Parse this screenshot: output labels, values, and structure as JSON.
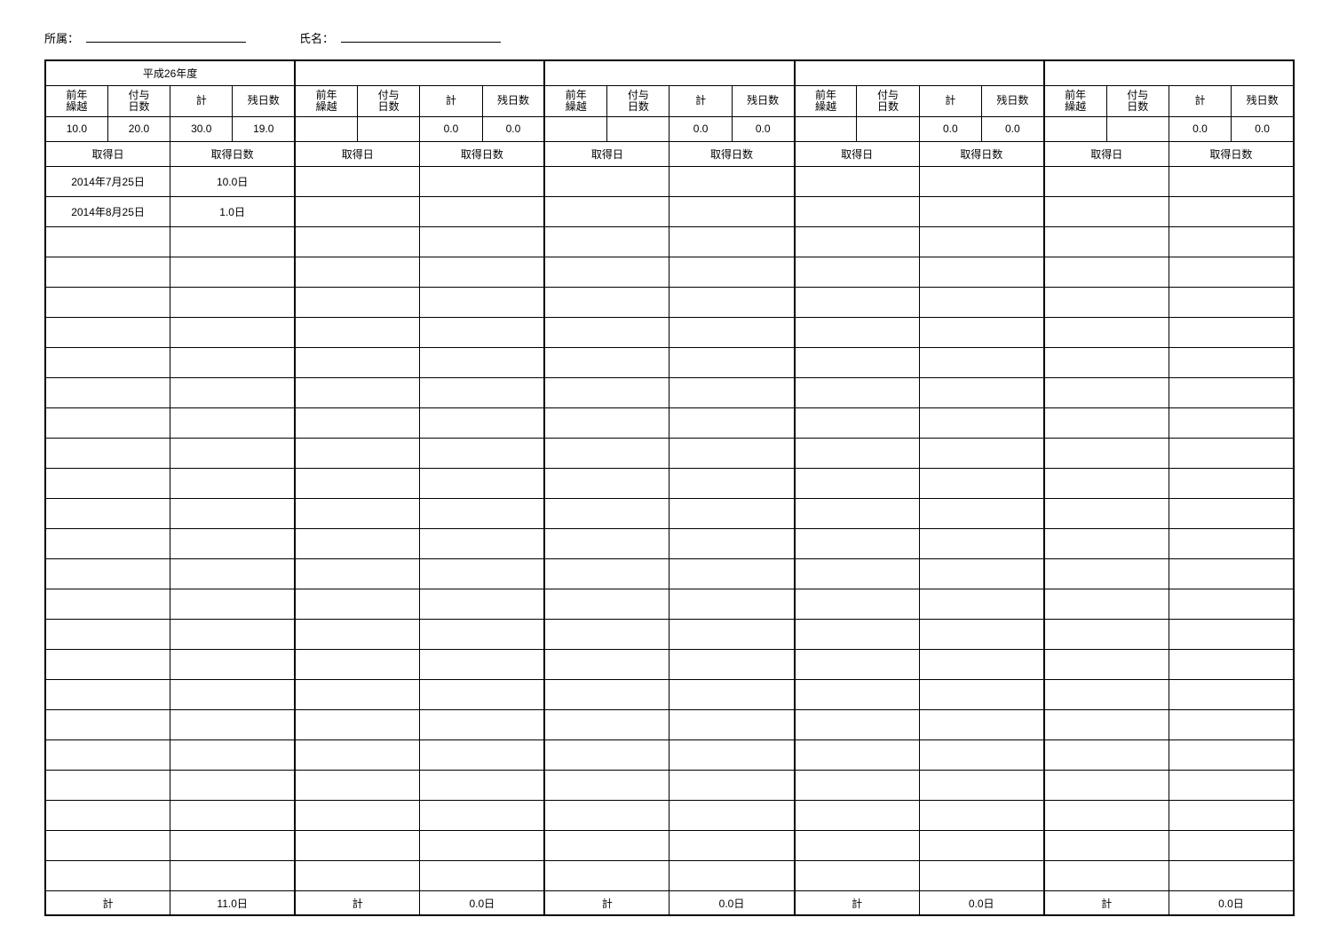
{
  "header": {
    "affiliation_label": "所属：",
    "affiliation_value": "",
    "name_label": "氏名：",
    "name_value": ""
  },
  "period_titles": [
    "平成26年度",
    "",
    "",
    "",
    ""
  ],
  "column_headers": {
    "carryover": "前年\n繰越",
    "granted": "付与\n日数",
    "total": "計",
    "remaining": "残日数",
    "acq_date": "取得日",
    "acq_days": "取得日数"
  },
  "summary_values": [
    {
      "carryover": "10.0",
      "granted": "20.0",
      "total": "30.0",
      "remaining": "19.0"
    },
    {
      "carryover": "",
      "granted": "",
      "total": "0.0",
      "remaining": "0.0"
    },
    {
      "carryover": "",
      "granted": "",
      "total": "0.0",
      "remaining": "0.0"
    },
    {
      "carryover": "",
      "granted": "",
      "total": "0.0",
      "remaining": "0.0"
    },
    {
      "carryover": "",
      "granted": "",
      "total": "0.0",
      "remaining": "0.0"
    }
  ],
  "entries": [
    [
      {
        "date": "2014年7月25日",
        "days": "10.0日"
      },
      {
        "date": "2014年8月25日",
        "days": "1.0日"
      }
    ],
    [],
    [],
    [],
    []
  ],
  "empty_rows_total": 24,
  "footer": {
    "label": "計",
    "totals": [
      "11.0日",
      "0.0日",
      "0.0日",
      "0.0日",
      "0.0日"
    ]
  }
}
